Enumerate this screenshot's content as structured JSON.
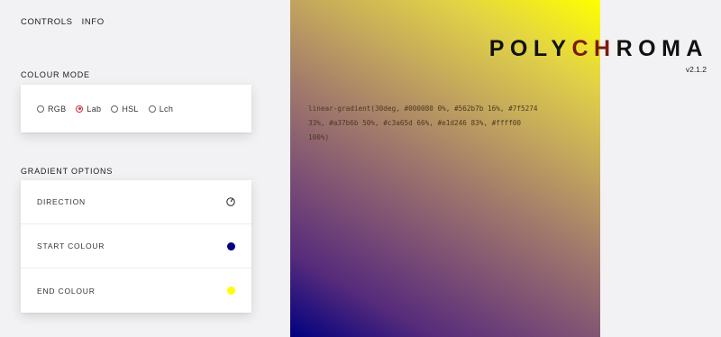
{
  "nav": {
    "controls": "CONTROLS",
    "info": "INFO"
  },
  "colour_mode": {
    "title": "COLOUR MODE",
    "options": [
      {
        "label": "RGB",
        "checked": false
      },
      {
        "label": "Lab",
        "checked": true
      },
      {
        "label": "HSL",
        "checked": false
      },
      {
        "label": "Lch",
        "checked": false
      }
    ]
  },
  "gradient_options": {
    "title": "GRADIENT OPTIONS",
    "direction_label": "DIRECTION",
    "start_label": "START COLOUR",
    "start_color": "#000080",
    "end_label": "END COLOUR",
    "end_color": "#ffff00"
  },
  "output": {
    "css": "linear-gradient(30deg, #000080 0%, #562b7b 16%, #7f5274 33%, #a37b6b 50%, #c3a65d 66%, #e1d246 83%, #ffff00 100%)"
  },
  "brand": {
    "name_part1": "POLY",
    "name_part2": "CH",
    "name_part3": "ROMA",
    "version": "v2.1.2"
  }
}
